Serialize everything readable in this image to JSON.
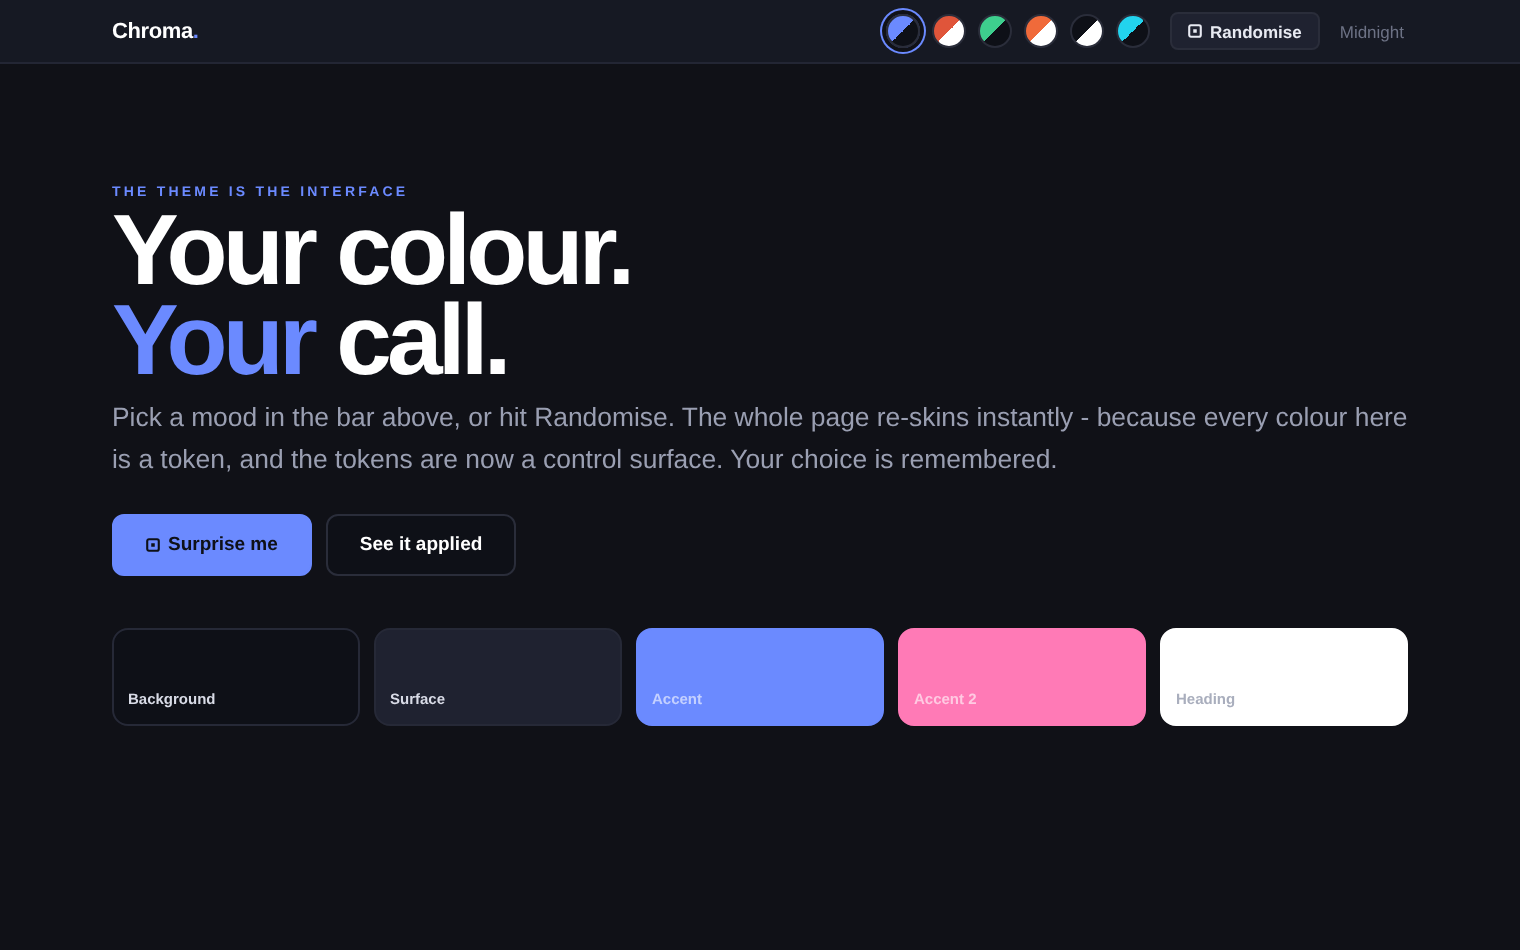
{
  "brand": {
    "name": "Chroma",
    "dot": "."
  },
  "themes": [
    {
      "color": "#6b8aff",
      "kind": "dark",
      "selected": true
    },
    {
      "color": "#e0553a",
      "kind": "light",
      "selected": false
    },
    {
      "color": "#3ecf8e",
      "kind": "dark",
      "selected": false
    },
    {
      "color": "#f06a3a",
      "kind": "light",
      "selected": false
    },
    {
      "color": "#0e1017",
      "kind": "light",
      "selected": false
    },
    {
      "color": "#22d3ee",
      "kind": "dark",
      "selected": false
    }
  ],
  "randomise_button": "Randomise",
  "theme_name": "Midnight",
  "eyebrow": "THE THEME IS THE INTERFACE",
  "headline": {
    "line1": "Your colour.",
    "accent": "Your",
    "rest": "call."
  },
  "intro": "Pick a mood in the bar above, or hit Randomise. The whole page re-skins instantly - because every colour here is a token, and the tokens are now a control surface. Your choice is remembered.",
  "buttons": [
    {
      "label": "Surprise me",
      "kind": "primary"
    },
    {
      "label": "See it applied",
      "kind": "secondary"
    }
  ],
  "swatches": [
    {
      "label": "Background",
      "color": "#0e1017"
    },
    {
      "label": "Surface",
      "color": "#1f2230"
    },
    {
      "label": "Accent",
      "color": "#6b8aff"
    },
    {
      "label": "Accent 2",
      "color": "#ff7ab6"
    },
    {
      "label": "Heading",
      "color": "#ffffff"
    }
  ]
}
